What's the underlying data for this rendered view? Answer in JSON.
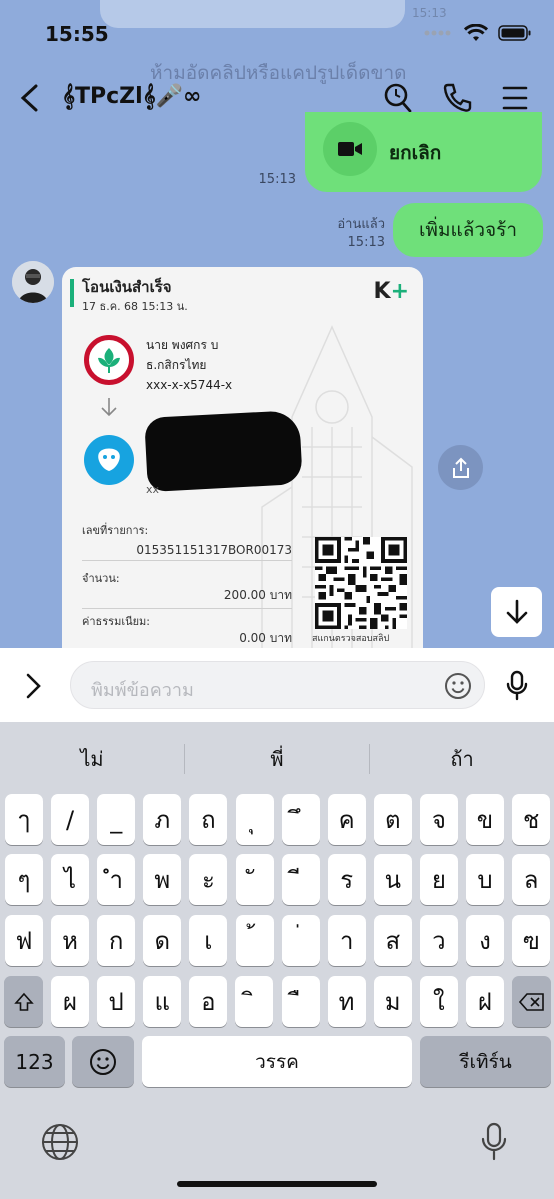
{
  "status_bar": {
    "time": "15:55"
  },
  "background": {
    "faded_time": "15:13",
    "faded_banner": "ห้ามอัดคลิปหรือแคปรูปเด็ดขาด"
  },
  "header": {
    "title": "𝄞TPcZl𝄞🎤∞",
    "icons": [
      "back-arrow",
      "search",
      "phone",
      "menu"
    ]
  },
  "messages": {
    "call": {
      "label": "ยกเลิก",
      "time": "15:13"
    },
    "text": {
      "label": "เพิ่มแล้วจร้า",
      "read": "อ่านแล้ว",
      "time": "15:13"
    }
  },
  "slip": {
    "title": "โอนเงินสำเร็จ",
    "date": "17 ธ.ค. 68  15:13 น.",
    "brand": "K",
    "brand_plus": "+",
    "sender_name": "นาย พงศกร บ",
    "sender_bank": "ธ.กสิกรไทย",
    "sender_account": "xxx-x-x5744-x",
    "receiver_peek": "xx",
    "ref_label": "เลขที่รายการ:",
    "ref_value": "015351151317BOR00173",
    "amount_label": "จำนวน:",
    "amount_value": "200.00 บาท",
    "fee_label": "ค่าธรรมเนียม:",
    "fee_value": "0.00 บาท",
    "qr_caption": "สแกนตรวจสอบสลิป"
  },
  "input": {
    "placeholder": "พิมพ์ข้อความ"
  },
  "keyboard": {
    "suggestions": [
      "ไม่",
      "พี่",
      "ถ้า"
    ],
    "row1": [
      "ๅ",
      "/",
      "_",
      "ภ",
      "ถ",
      "ุ",
      "ึ",
      "ค",
      "ต",
      "จ",
      "ข",
      "ช"
    ],
    "row2": [
      "ๆ",
      "ไ",
      "ำ",
      "พ",
      "ะ",
      "ั",
      "ี",
      "ร",
      "น",
      "ย",
      "บ",
      "ล"
    ],
    "row3": [
      "ฟ",
      "ห",
      "ก",
      "ด",
      "เ",
      "้",
      "่",
      "า",
      "ส",
      "ว",
      "ง",
      "ฃ"
    ],
    "row4": [
      "ผ",
      "ป",
      "แ",
      "อ",
      "ิ",
      "ื",
      "ท",
      "ม",
      "ใ",
      "ฝ"
    ],
    "numbers_key": "123",
    "space_key": "วรรค",
    "return_key": "รีเทิร์น"
  }
}
